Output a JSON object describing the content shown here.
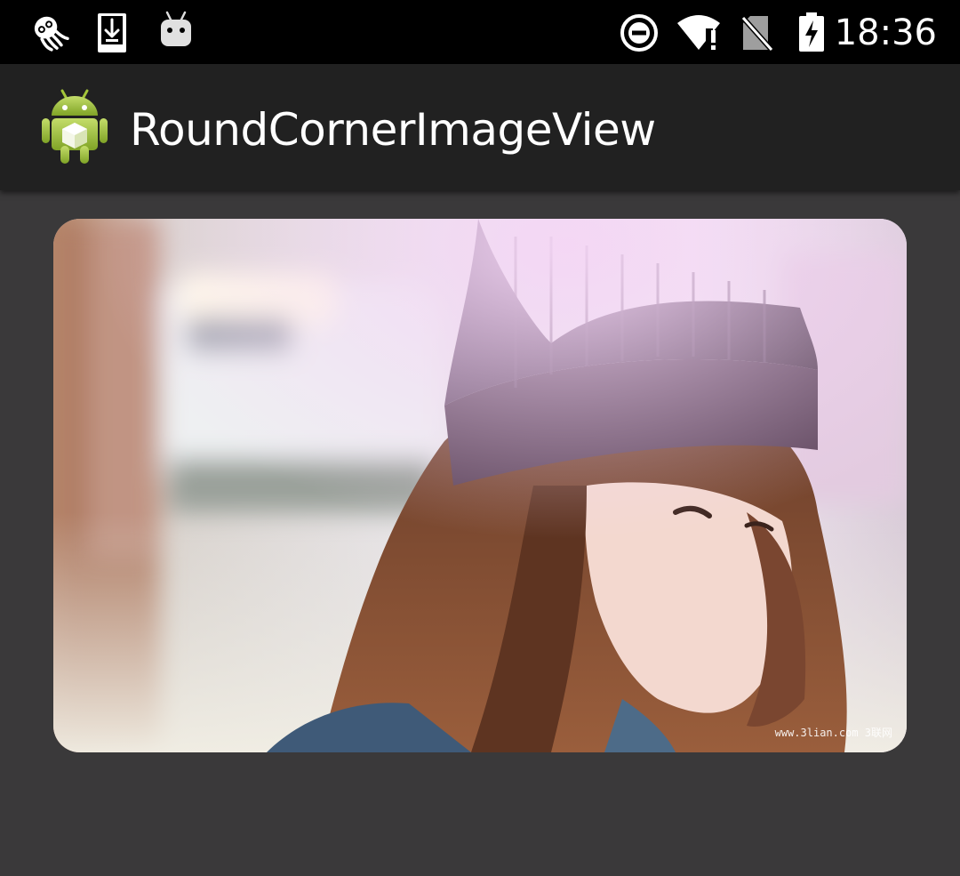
{
  "status_bar": {
    "time": "18:36",
    "left_icons": [
      "squid-icon",
      "download-icon",
      "android-robot-icon"
    ],
    "right_icons": [
      "do-not-disturb-icon",
      "wifi-alert-icon",
      "no-sim-icon",
      "battery-charging-icon"
    ]
  },
  "app_bar": {
    "title": "RoundCornerImageView",
    "logo": "android-app-icon"
  },
  "image": {
    "description_icon": "photo-image",
    "watermark": "www.3lian.com 3联网"
  },
  "colors": {
    "status_bar": "#000000",
    "app_bar": "#212121",
    "background": "#3a393a",
    "android_green": "#a4c639"
  }
}
